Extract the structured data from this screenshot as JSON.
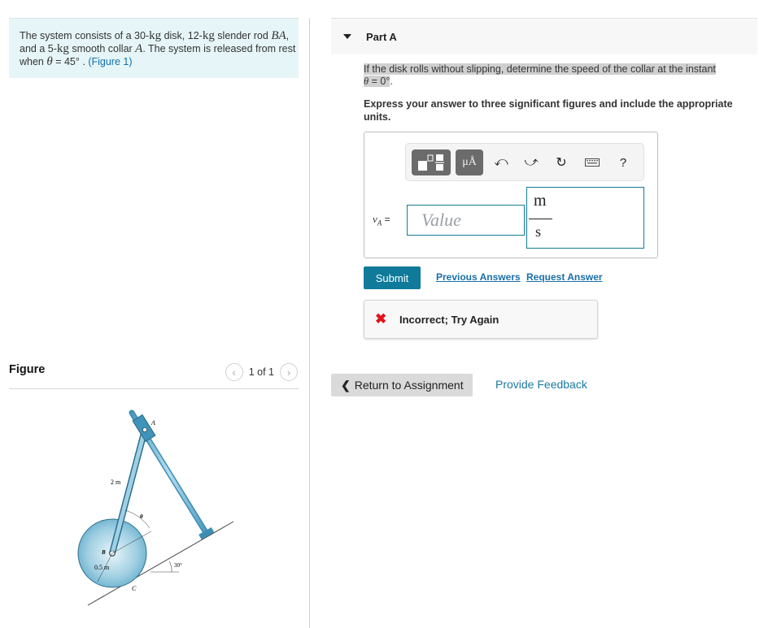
{
  "problem": {
    "text_1": "The system consists of a 30-",
    "unit_kg_1": "kg",
    "text_2": " disk, 12-",
    "unit_kg_2": "kg",
    "text_3": " slender rod",
    "var_BA": "BA",
    "text_4": ", and a 5-",
    "unit_kg_3": "kg",
    "text_5": " smooth collar ",
    "var_A": "A",
    "text_6": ". The system is released from rest when ",
    "theta": "θ",
    "text_7": " = 45° . ",
    "figure_link": "(Figure 1)"
  },
  "figure": {
    "title": "Figure",
    "pager_text": "1 of 1",
    "prev_icon": "chevron-left",
    "next_icon": "chevron-right",
    "labels": {
      "A": "A",
      "B": "B",
      "C": "C",
      "theta": "θ",
      "rod_length": "2 m",
      "radius": "0.5 m",
      "incline": "30°"
    }
  },
  "part": {
    "title": "Part A",
    "question_1": "If the disk rolls without slipping, determine the speed of the collar at the instant ",
    "question_theta": "θ",
    "question_2": " = 0°",
    "question_end": ".",
    "instruction": "Express your answer to three significant figures and include the appropriate units.",
    "toolbar": {
      "templates": "templates-icon",
      "units_label": "μÅ",
      "undo": "undo-icon",
      "redo": "redo-icon",
      "reset": "reset-icon",
      "keyboard": "keyboard-icon",
      "help_label": "?"
    },
    "answer_label_var": "v",
    "answer_label_sub": "A",
    "answer_label_eq": " =",
    "value_placeholder": "Value",
    "unit_numerator": "m",
    "unit_denominator": "s",
    "submit_label": "Submit",
    "previous_answers": "Previous Answers",
    "request_answer": "Request Answer",
    "feedback": "Incorrect; Try Again"
  },
  "footer": {
    "return_label": "Return to Assignment",
    "provide_feedback": "Provide Feedback"
  },
  "colors": {
    "accent": "#0f7a9a",
    "link": "#1a6fa8",
    "error": "#e0141a",
    "problem_bg": "#e6f5f7"
  }
}
